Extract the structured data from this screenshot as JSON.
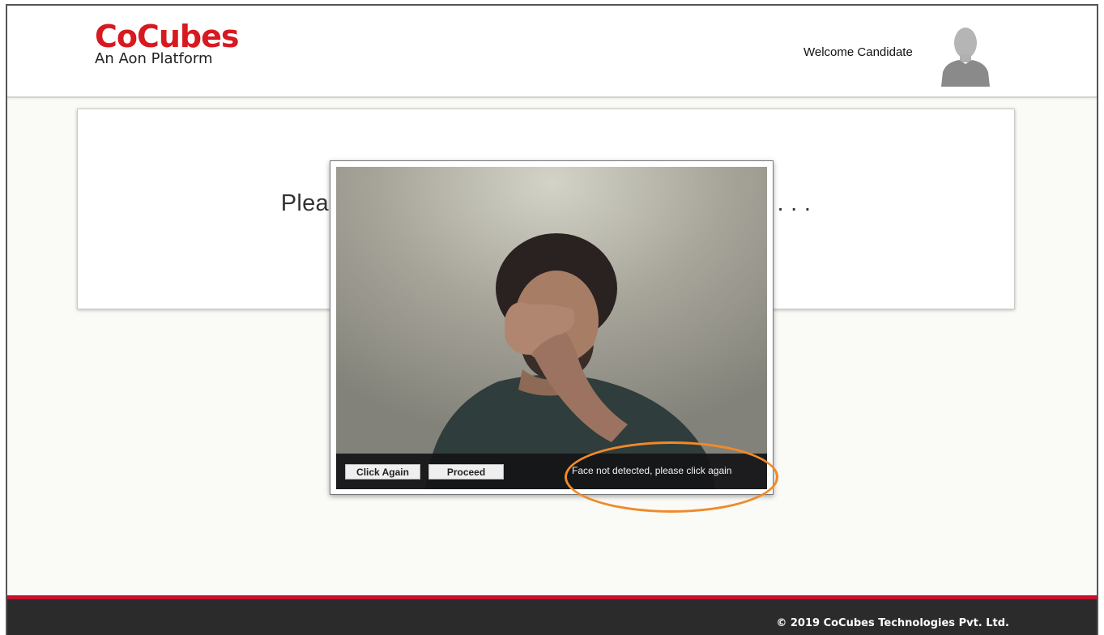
{
  "brand": {
    "name": "CoCubes",
    "tagline": "An Aon Platform",
    "color": "#d71920"
  },
  "header": {
    "welcome_text": "Welcome Candidate",
    "avatar_icon": "user-silhouette-icon"
  },
  "main": {
    "instruction_text": "Please adjust your position for a better picture . . ."
  },
  "capture_modal": {
    "click_again_label": "Click Again",
    "proceed_label": "Proceed",
    "status_message": "Face not detected, please click again",
    "highlight_color": "#f08a2a"
  },
  "footer": {
    "copyright": "© 2019 CoCubes Technologies Pvt. Ltd.",
    "accent_color": "#c8102e"
  }
}
